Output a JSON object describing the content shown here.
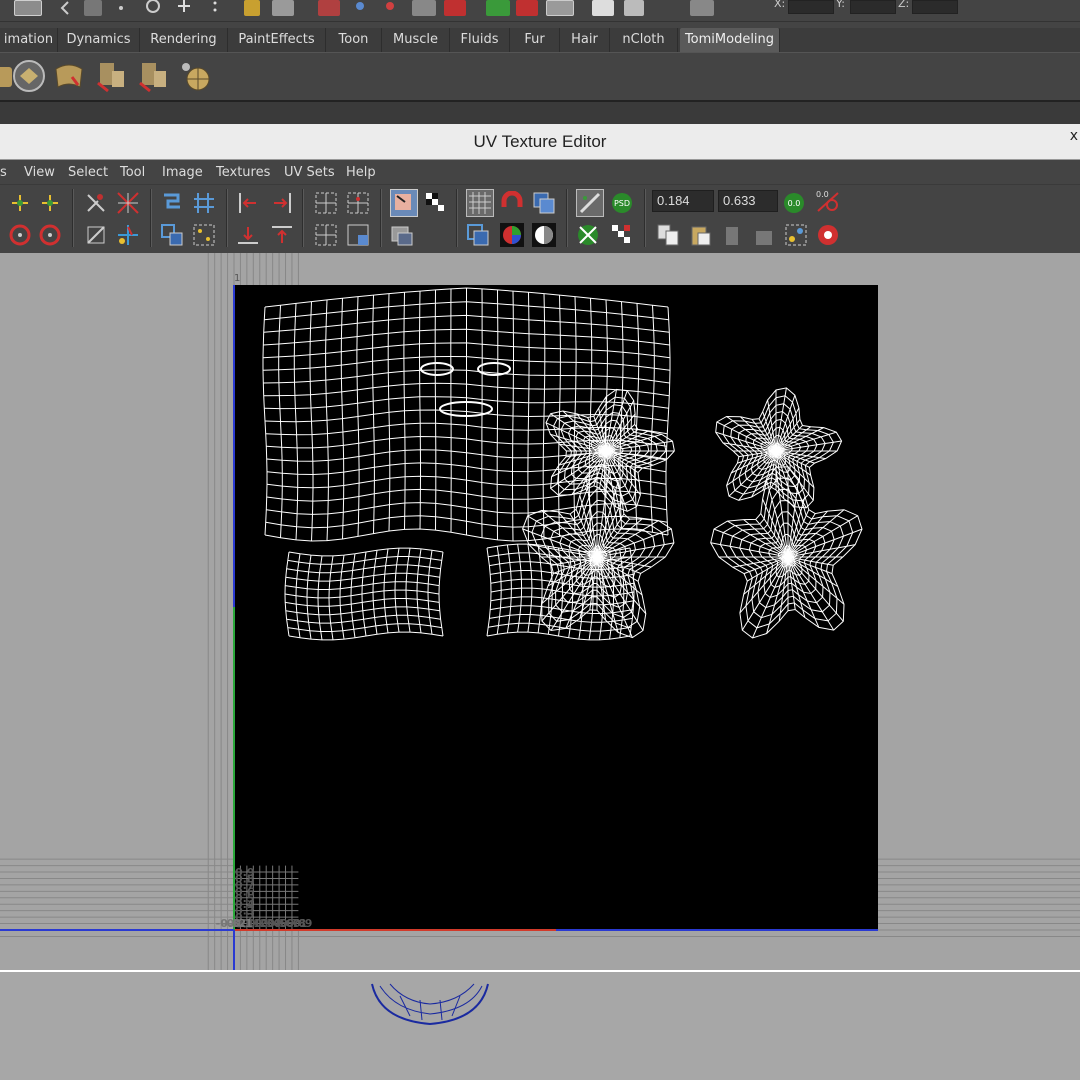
{
  "top_toolbar": {
    "coord_labels": [
      "X:",
      "Y:",
      "Z:"
    ]
  },
  "shelf_tabs": [
    {
      "label": "imation"
    },
    {
      "label": "Dynamics"
    },
    {
      "label": "Rendering"
    },
    {
      "label": "PaintEffects"
    },
    {
      "label": "Toon"
    },
    {
      "label": "Muscle"
    },
    {
      "label": "Fluids"
    },
    {
      "label": "Fur"
    },
    {
      "label": "Hair"
    },
    {
      "label": "nCloth"
    },
    {
      "label": "TomiModeling",
      "active": true
    }
  ],
  "window": {
    "title": "UV Texture Editor",
    "close_glyph": "x"
  },
  "menu": [
    "s",
    "View",
    "Select",
    "Tool",
    "Image",
    "Textures",
    "UV Sets",
    "Help"
  ],
  "toolbar": {
    "u_value": "0.184",
    "v_value": "0.633",
    "icon_labels": [
      "0.0",
      "0.0",
      "PSD"
    ]
  },
  "uv_grid": {
    "top_label": "1",
    "v_ticks": [
      "0.9",
      "0.8",
      "0.7",
      "0.6",
      "0.5",
      "0.4",
      "0.3",
      "0.2",
      "0.1"
    ],
    "u_ticks": [
      "0",
      "0.1",
      "0.2",
      "0.3",
      "0.4",
      "0.5",
      "0.6",
      "0.7",
      "0.8",
      "0.9",
      "1"
    ],
    "neg_u_ticks": [
      "-0.3",
      "-0.2",
      "-0.1"
    ],
    "colors": {
      "u_axis": "#d23a2a",
      "v_axis": "#2aa83a",
      "border": "#2a3ad2",
      "wire": "#ffffff",
      "texture_bg": "#000000"
    }
  }
}
